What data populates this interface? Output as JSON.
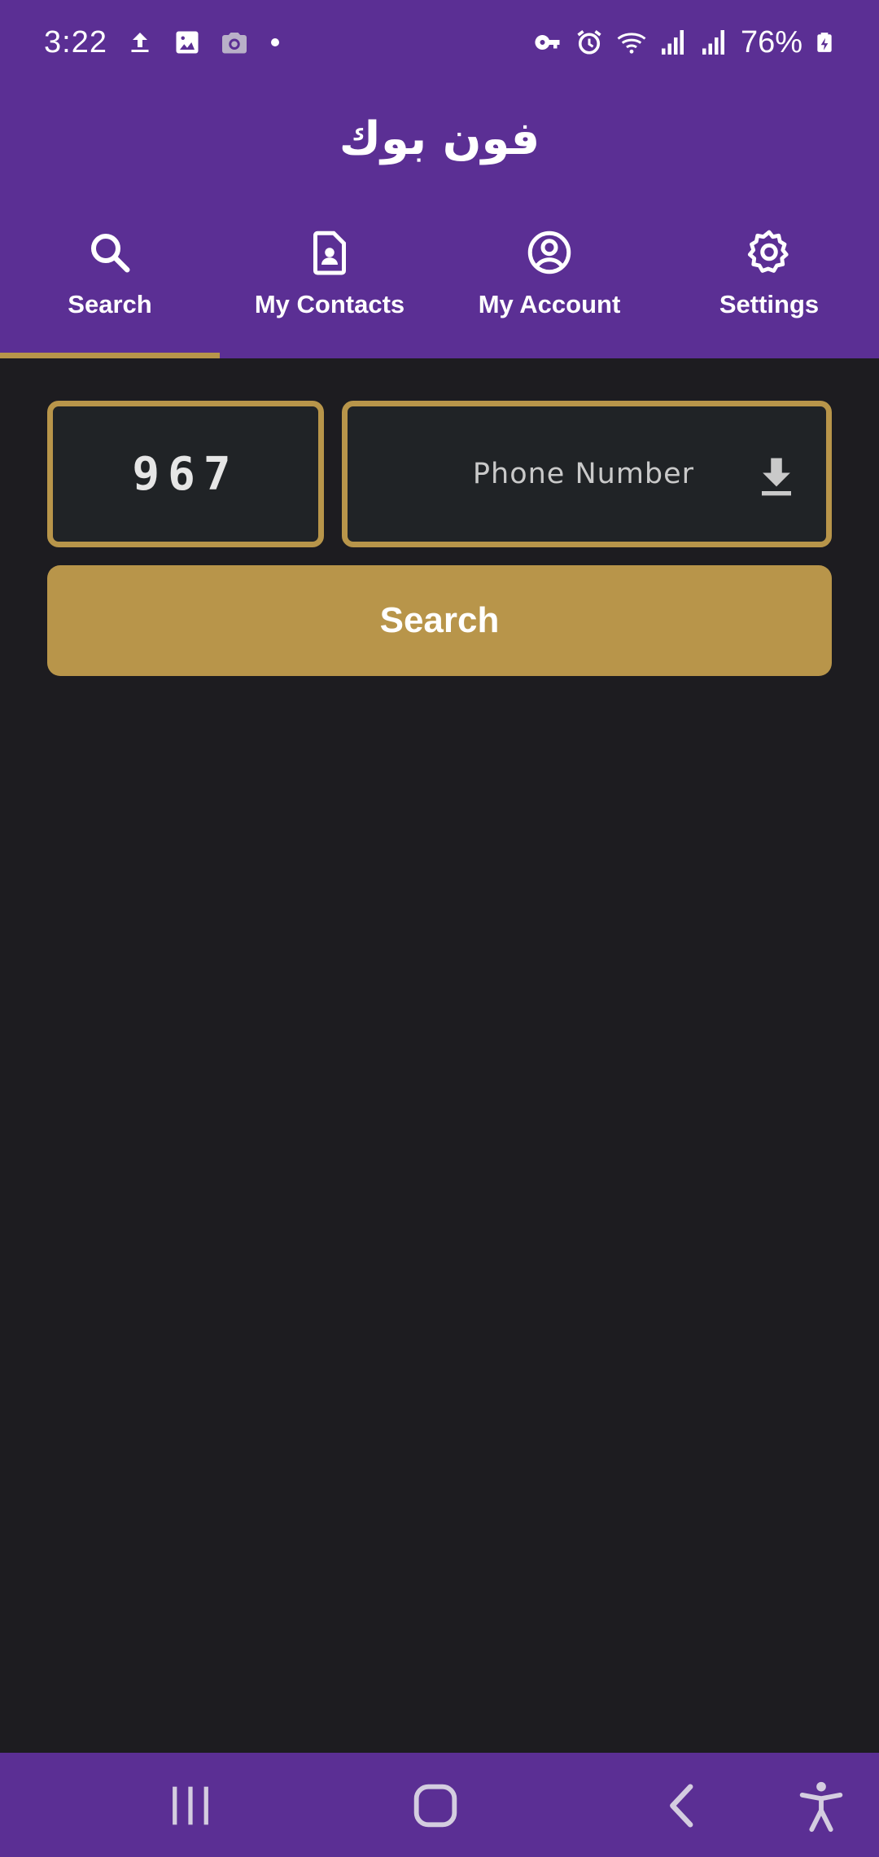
{
  "status_bar": {
    "time": "3:22",
    "battery": "76%",
    "left_icons": [
      "upload-icon",
      "image-icon",
      "camera-icon",
      "dot-icon"
    ],
    "right_icons": [
      "vpn-key-icon",
      "alarm-icon",
      "wifi-icon",
      "signal-icon",
      "signal-icon",
      "battery-charging-icon"
    ]
  },
  "header": {
    "title": "فون بوك"
  },
  "tabs": [
    {
      "label": "Search",
      "icon": "search-icon",
      "active": true
    },
    {
      "label": "My Contacts",
      "icon": "contact-card-icon",
      "active": false
    },
    {
      "label": "My Account",
      "icon": "account-circle-icon",
      "active": false
    },
    {
      "label": "Settings",
      "icon": "gear-icon",
      "active": false
    }
  ],
  "form": {
    "country_code": "967",
    "phone_placeholder": "Phone Number",
    "phone_value": "",
    "search_label": "Search"
  },
  "nav_bar": {
    "buttons": [
      "recent-apps-icon",
      "home-icon",
      "back-icon",
      "accessibility-icon"
    ]
  },
  "colors": {
    "primary": "#5b2f94",
    "accent": "#b8954a",
    "background": "#1d1c20",
    "field_background": "#202326"
  }
}
